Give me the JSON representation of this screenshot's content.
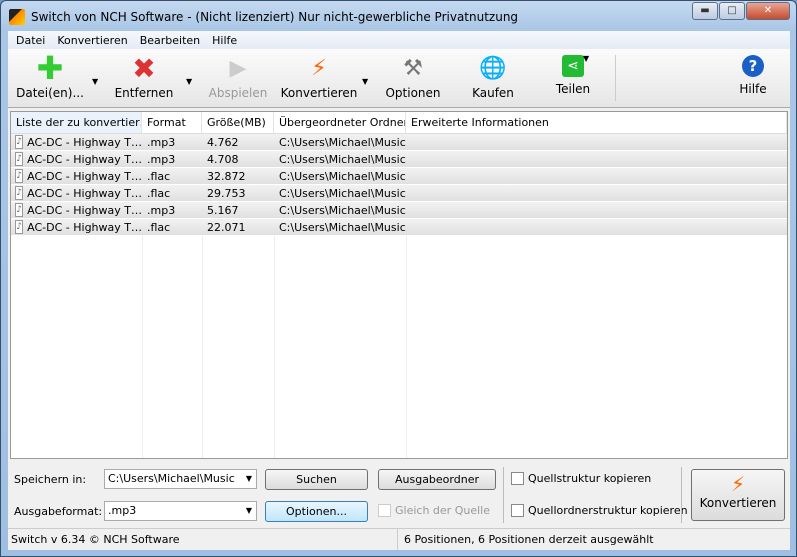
{
  "window": {
    "title": "Switch von NCH Software - (Nicht lizenziert) Nur nicht-gewerbliche Privatnutzung",
    "minimize": "▬",
    "maximize": "□",
    "close": "✕"
  },
  "menu": [
    "Datei",
    "Konvertieren",
    "Bearbeiten",
    "Hilfe"
  ],
  "toolbar": {
    "add": "Datei(en)...",
    "remove": "Entfernen",
    "play": "Abspielen",
    "convert": "Konvertieren",
    "options": "Optionen",
    "buy": "Kaufen",
    "share": "Teilen",
    "help": "Hilfe"
  },
  "list": {
    "columns": [
      "Liste der zu konvertier…",
      "Format",
      "Größe(MB)",
      "Übergeordneter Ordner",
      "Erweiterte Informationen"
    ],
    "rows": [
      [
        "AC-DC - Highway T…",
        ".mp3",
        "4.762",
        "C:\\Users\\Michael\\Music",
        ""
      ],
      [
        "AC-DC - Highway T…",
        ".mp3",
        "4.708",
        "C:\\Users\\Michael\\Music",
        ""
      ],
      [
        "AC-DC - Highway T…",
        ".flac",
        "32.872",
        "C:\\Users\\Michael\\Music",
        ""
      ],
      [
        "AC-DC - Highway T…",
        ".flac",
        "29.753",
        "C:\\Users\\Michael\\Music",
        ""
      ],
      [
        "AC-DC - Highway T…",
        ".mp3",
        "5.167",
        "C:\\Users\\Michael\\Music",
        ""
      ],
      [
        "AC-DC - Highway T…",
        ".flac",
        "22.071",
        "C:\\Users\\Michael\\Music",
        ""
      ]
    ]
  },
  "bottom": {
    "save_label": "Speichern in:",
    "save_value": "C:\\Users\\Michael\\Music",
    "search": "Suchen",
    "output_folder": "Ausgabeordner",
    "format_label": "Ausgabeformat:",
    "format_value": ".mp3",
    "options": "Optionen...",
    "same_as_source": "Gleich der Quelle",
    "copy_structure": "Quellstruktur kopieren",
    "copy_folder_structure": "Quellordnerstruktur kopieren",
    "convert": "Konvertieren"
  },
  "status": {
    "version": "Switch v 6.34 © NCH Software",
    "selection": "6 Positionen, 6 Positionen derzeit ausgewählt"
  }
}
